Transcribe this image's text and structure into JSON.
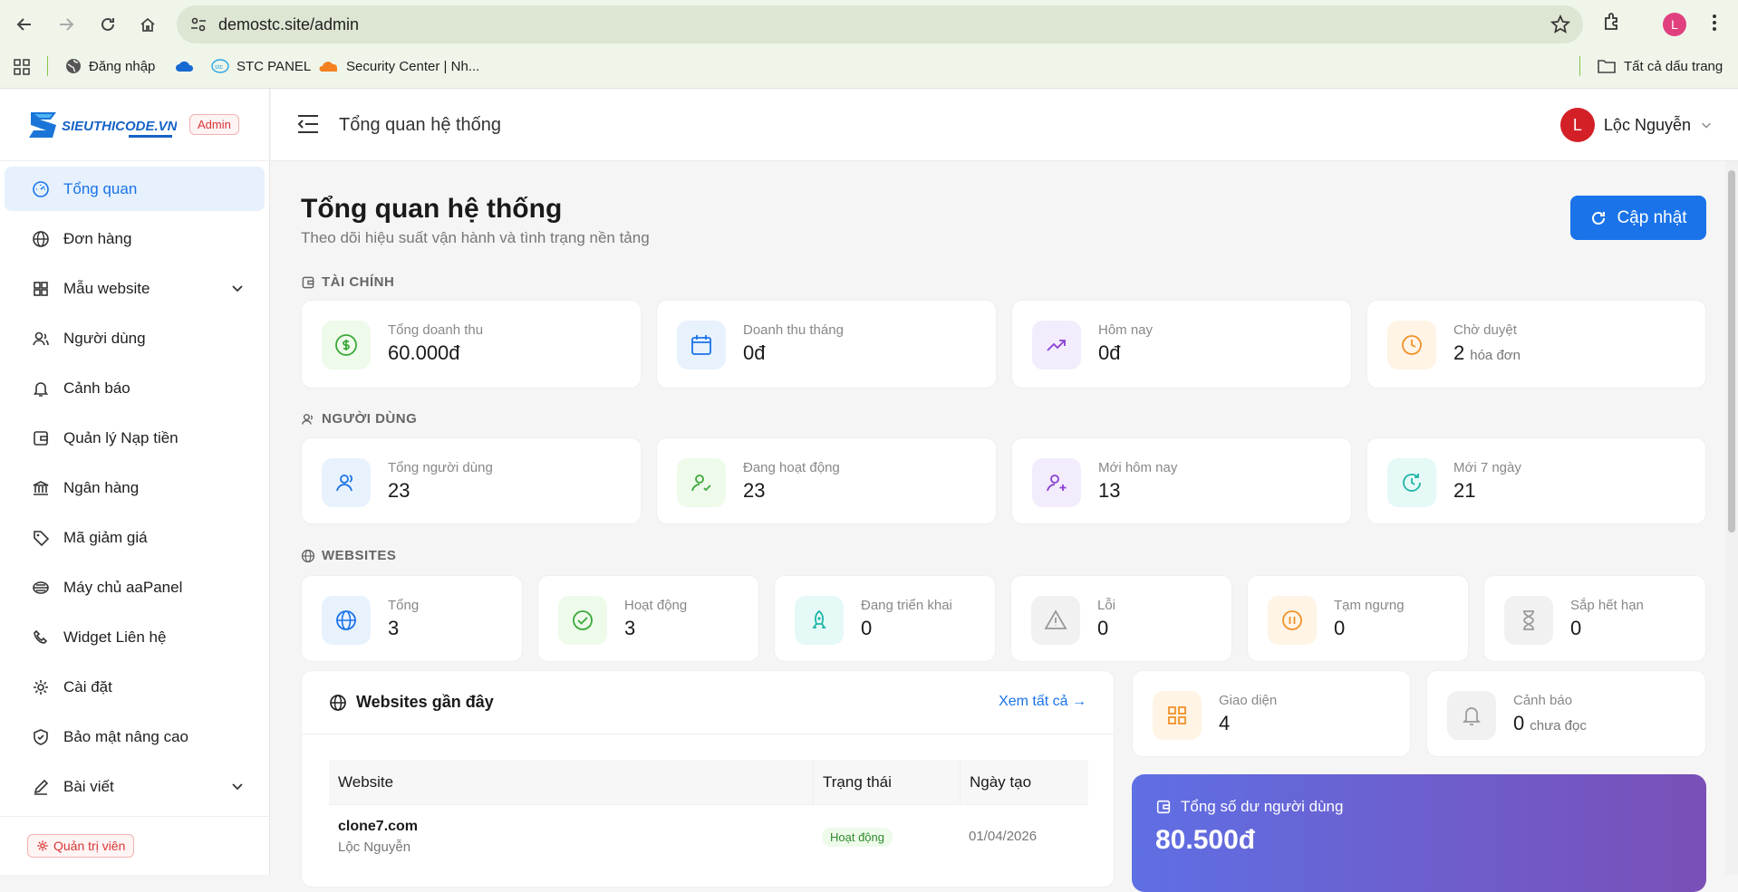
{
  "browser": {
    "url": "demostc.site/admin",
    "profile_initial": "L",
    "bookmarks": [
      {
        "label": "Đăng nhập",
        "icon": "globe-icon"
      },
      {
        "label": "",
        "icon": "onedrive-cloud-icon"
      },
      {
        "label": "STC PANEL",
        "icon": "stc-icon"
      },
      {
        "label": "Security Center | Nh...",
        "icon": "cloudflare-icon"
      }
    ],
    "all_bookmarks_label": "Tất cả dấu trang"
  },
  "sidebar": {
    "logo_text": "SIEUTHICODE.VN",
    "admin_badge": "Admin",
    "items": [
      {
        "label": "Tổng quan",
        "icon": "dashboard-gauge-icon"
      },
      {
        "label": "Đơn hàng",
        "icon": "globe-icon"
      },
      {
        "label": "Mẫu website",
        "icon": "grid-icon"
      },
      {
        "label": "Người dùng",
        "icon": "users-icon"
      },
      {
        "label": "Cảnh báo",
        "icon": "bell-icon"
      },
      {
        "label": "Quản lý Nạp tiền",
        "icon": "wallet-icon"
      },
      {
        "label": "Ngân hàng",
        "icon": "bank-icon"
      },
      {
        "label": "Mã giảm giá",
        "icon": "tag-icon"
      },
      {
        "label": "Máy chủ aaPanel",
        "icon": "server-icon"
      },
      {
        "label": "Widget Liên hệ",
        "icon": "phone-icon"
      },
      {
        "label": "Cài đặt",
        "icon": "gear-icon"
      },
      {
        "label": "Bảo mật nâng cao",
        "icon": "shield-icon"
      },
      {
        "label": "Bài viết",
        "icon": "pen-icon"
      }
    ],
    "footer_role": "Quản trị viên"
  },
  "topbar": {
    "title": "Tổng quan hệ thống",
    "user_initial": "L",
    "user_name": "Lộc Nguyễn"
  },
  "page": {
    "title": "Tổng quan hệ thống",
    "subtitle": "Theo dõi hiệu suất vận hành và tình trạng nền tảng",
    "refresh_label": "Cập nhật"
  },
  "finance": {
    "section_label": "TÀI CHÍNH",
    "cards": [
      {
        "label": "Tổng doanh thu",
        "value": "60.000đ",
        "suffix": ""
      },
      {
        "label": "Doanh thu tháng",
        "value": "0đ",
        "suffix": ""
      },
      {
        "label": "Hôm nay",
        "value": "0đ",
        "suffix": ""
      },
      {
        "label": "Chờ duyệt",
        "value": "2",
        "suffix": "hóa đơn"
      }
    ]
  },
  "users": {
    "section_label": "NGƯỜI DÙNG",
    "cards": [
      {
        "label": "Tổng người dùng",
        "value": "23"
      },
      {
        "label": "Đang hoạt động",
        "value": "23"
      },
      {
        "label": "Mới hôm nay",
        "value": "13"
      },
      {
        "label": "Mới 7 ngày",
        "value": "21"
      }
    ]
  },
  "websites": {
    "section_label": "WEBSITES",
    "cards": [
      {
        "label": "Tổng",
        "value": "3"
      },
      {
        "label": "Hoạt động",
        "value": "3"
      },
      {
        "label": "Đang triển khai",
        "value": "0"
      },
      {
        "label": "Lỗi",
        "value": "0"
      },
      {
        "label": "Tạm ngưng",
        "value": "0"
      },
      {
        "label": "Sắp hết hạn",
        "value": "0"
      }
    ]
  },
  "recent": {
    "title": "Websites gần đây",
    "see_all": "Xem tất cả →",
    "columns": [
      "Website",
      "Trạng thái",
      "Ngày tạo"
    ],
    "rows": [
      {
        "site": "clone7.com",
        "owner": "Lộc Nguyễn",
        "status": "Hoạt động",
        "date": "01/04/2026"
      }
    ]
  },
  "side_cards": [
    {
      "label": "Giao diện",
      "value": "4",
      "suffix": ""
    },
    {
      "label": "Cảnh báo",
      "value": "0",
      "suffix": "chưa đọc"
    }
  ],
  "balance": {
    "label": "Tổng số dư người dùng",
    "value": "80.500đ"
  },
  "colors": {
    "primary": "#1a73e8",
    "danger": "#d93636",
    "balance_gradient_start": "#5f6fe4",
    "balance_gradient_end": "#7a4fb8"
  }
}
